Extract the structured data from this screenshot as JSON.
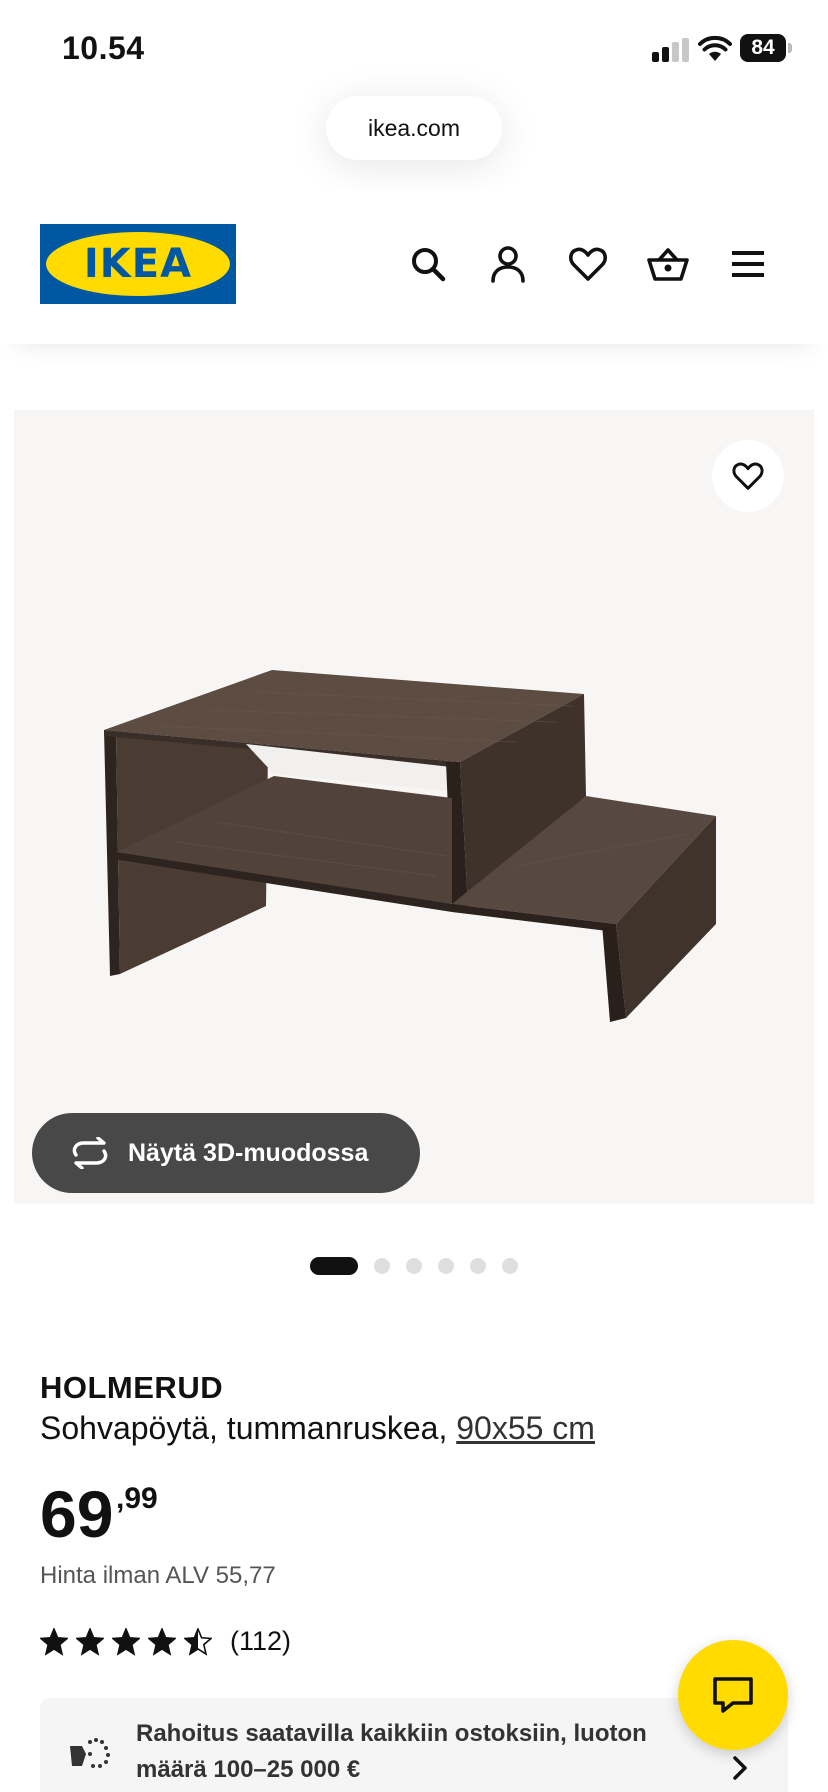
{
  "status_bar": {
    "time": "10.54",
    "battery": "84"
  },
  "browser": {
    "url": "ikea.com"
  },
  "header": {
    "logo_text": "IKEA",
    "icons": [
      "search-icon",
      "account-icon",
      "favourites-icon",
      "basket-icon",
      "menu-icon"
    ]
  },
  "gallery": {
    "view_3d_label": "Näytä 3D-muodossa",
    "slide_count": 6,
    "active_slide": 1
  },
  "product": {
    "name": "HOLMERUD",
    "description": "Sohvapöytä, tummanruskea,",
    "size": "90x55 cm",
    "price_integer": "69",
    "price_decimals": ",99",
    "price_ex_vat": "Hinta ilman ALV 55,77",
    "rating_value": 4.5,
    "rating_max": 5,
    "rating_count": "(112)"
  },
  "financing": {
    "text": "Rahoitus saatavilla kaikkiin ostoksiin, luoton määrä 100–25 000 €"
  },
  "colors": {
    "ikea_blue": "#0058a3",
    "ikea_yellow": "#ffdb00",
    "button_dark": "#484848"
  }
}
